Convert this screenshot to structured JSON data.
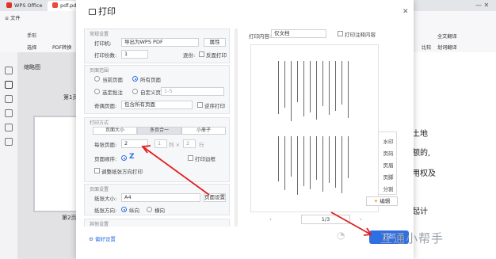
{
  "app": {
    "brand": "WPS Office",
    "tab_pdf": "pdf.pdf",
    "menu_file": "文件",
    "menu_items": [
      "手形",
      "选择",
      "PDF转换",
      "播放"
    ],
    "right_items": [
      "全文翻译",
      "划词翻译",
      "比较"
    ]
  },
  "thumbs": {
    "title": "缩略图",
    "page1": "第1页",
    "page2": "第2页"
  },
  "doc_lines": [
    "、土地",
    "数额的,",
    "使用权及",
    "日起计"
  ],
  "dialog": {
    "title": "打印",
    "printer_section": "常规设置",
    "printer_label": "打印机:",
    "printer_value": "导出为WPS PDF",
    "properties_btn": "属性",
    "copies_label": "打印份数:",
    "copies_value": "1",
    "collate_label": "逐份:",
    "collate_check": "反面打印",
    "range_section": "页面范围",
    "range_current": "当前页面",
    "range_all": "所有页面",
    "range_selected": "选定批注",
    "range_custom": "自定义页",
    "range_placeholder": "1-5",
    "subset_label": "奇偶页面:",
    "subset_value": "包含所有页面",
    "reverse_label": "逆序打印",
    "mode_section": "打印方式",
    "mode_tabs": [
      "页面大小",
      "多页合一",
      "小册子"
    ],
    "pages_per_sheet_label": "每张页面:",
    "pages_per_sheet_value": "2",
    "grid_value": "1",
    "grid_sep": "列 ×",
    "grid_rows": "2",
    "grid_unit": "行",
    "order_label": "页面顺序:",
    "order_value": "Z",
    "border_label": "打印边框",
    "auto_rotate_label": "调整纸张方向打印",
    "paper_section": "页面设置",
    "paper_size_label": "纸张大小:",
    "paper_size_value": "A4",
    "page_setup_btn": "页面设置",
    "orientation_label": "纸张方向:",
    "orientation_portrait": "纵向",
    "orientation_landscape": "横向",
    "more_section": "其他设置",
    "footer_link": "偏好设置",
    "print_content_label": "打印内容:",
    "print_content_value": "仅文档",
    "print_annotations": "打印注释内容",
    "side_menu": [
      "水印",
      "页码",
      "页眉",
      "页脚",
      "分割"
    ],
    "edit_btn": "编辑",
    "pager": "1/3",
    "print_btn": "打印"
  },
  "watermark": {
    "text": "互通小帮手"
  }
}
